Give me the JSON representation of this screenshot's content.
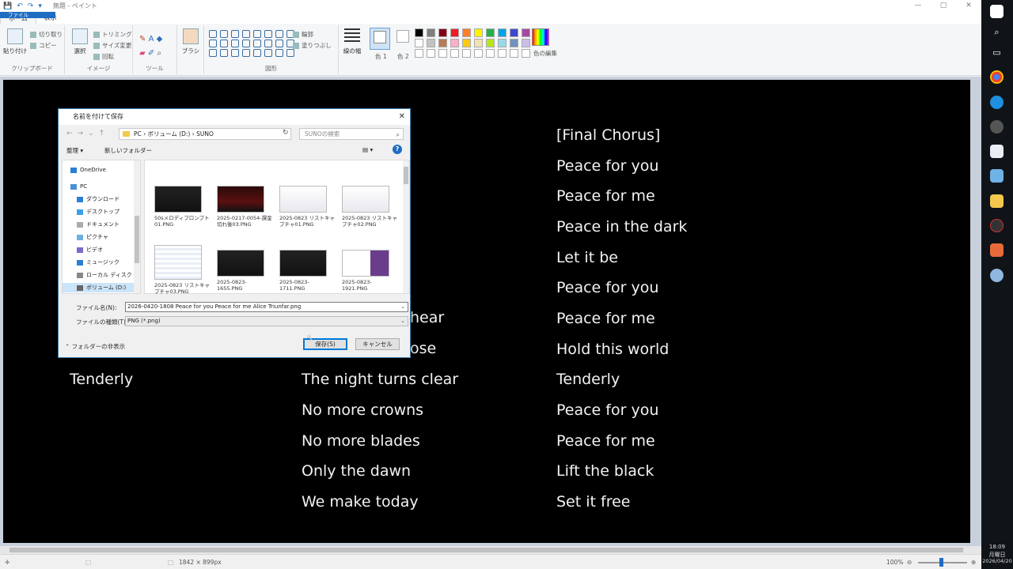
{
  "titlebar": {
    "title": "無題 - ペイント",
    "quick_access": [
      "💾",
      "↶",
      "↷",
      "▾"
    ],
    "window_controls": [
      "—",
      "▢",
      "✕"
    ]
  },
  "tabs": [
    "ファイル",
    "ホーム",
    "表示"
  ],
  "ribbon": {
    "clipboard": {
      "paste": "貼り付け",
      "cut": "切り取り",
      "copy": "コピー",
      "label": "クリップボード"
    },
    "image": {
      "select": "選択",
      "crop": "トリミング",
      "resize": "サイズ変更",
      "rotate": "回転",
      "label": "イメージ"
    },
    "tools": {
      "label": "ツール"
    },
    "brushes": "ブラシ",
    "shapes": {
      "outline": "輪郭",
      "fill": "塗りつぶし",
      "label": "図形"
    },
    "size": "線の幅",
    "color1": "色 1",
    "color2": "色 2",
    "edit_colors": "色の編集"
  },
  "palette": [
    "#000000",
    "#7f7f7f",
    "#880015",
    "#ed1c24",
    "#ff7f27",
    "#fff200",
    "#22b14c",
    "#00a2e8",
    "#3f48cc",
    "#a349a4",
    "#ffffff",
    "#c3c3c3",
    "#b97a57",
    "#ffaec9",
    "#ffc90e",
    "#efe4b0",
    "#b5e61d",
    "#99d9ea",
    "#7092be",
    "#c8bfe7",
    "#ffffff",
    "#ffffff",
    "#ffffff",
    "#ffffff",
    "#ffffff",
    "#ffffff",
    "#ffffff",
    "#ffffff",
    "#ffffff",
    "#ffffff"
  ],
  "lyrics": {
    "col1": [
      "Tenderly"
    ],
    "col2_partial": [
      "hear",
      "ose"
    ],
    "col2": [
      "The night turns clear",
      "No more crowns",
      "No more blades",
      "Only the dawn",
      "We make today"
    ],
    "col3": [
      "[Final Chorus]",
      "Peace for you",
      "Peace for me",
      "Peace in the dark",
      "Let it be",
      "Peace for you",
      "Peace for me",
      "Hold this world",
      "Tenderly",
      "Peace for you",
      "Peace for me",
      "Lift the black",
      "Set it free"
    ]
  },
  "status": {
    "canvas_size": "1842 × 899px",
    "zoom": "100%"
  },
  "clock": {
    "time": "18:09",
    "day": "月曜日",
    "date": "2026/04/20"
  },
  "dialog": {
    "title": "名前を付けて保存",
    "path": [
      "PC",
      "ボリューム (D:)",
      "SUNO"
    ],
    "search_placeholder": "SUNOの検索",
    "organize": "整理 ▾",
    "new_folder": "新しいフォルダー",
    "nav": [
      "OneDrive",
      "PC",
      "ダウンロード",
      "デスクトップ",
      "ドキュメント",
      "ピクチャ",
      "ビデオ",
      "ミュージック",
      "ローカル ディスク (C",
      "ボリューム (D:)"
    ],
    "files": [
      {
        "name": "50sメロディプロンプト01.PNG",
        "thumb": "t-dark"
      },
      {
        "name": "2025-0217-0054-課金切れ後03.PNG",
        "thumb": "t-red"
      },
      {
        "name": "2025-0823 リストキャプチャ01.PNG",
        "thumb": "t-light"
      },
      {
        "name": "2025-0823 リストキャプチャ02.PNG",
        "thumb": "t-light"
      },
      {
        "name": "2025-0823 リストキャプチャ03.PNG",
        "thumb": "t-grid"
      },
      {
        "name": "2025-0823-1655.PNG",
        "thumb": "t-dark"
      },
      {
        "name": "2025-0823-1711.PNG",
        "thumb": "t-dark"
      },
      {
        "name": "2025-0823-1921.PNG",
        "thumb": "t-mix"
      }
    ],
    "filename_label": "ファイル名(N):",
    "filename_value": "2026-0420-1808 Peace for you Peace for me Alice Triunfar.png",
    "filetype_label": "ファイルの種類(T):",
    "filetype_value": "PNG (*.png)",
    "hide_folders": "フォルダーの非表示",
    "save": "保存(S)",
    "cancel": "キャンセル"
  }
}
